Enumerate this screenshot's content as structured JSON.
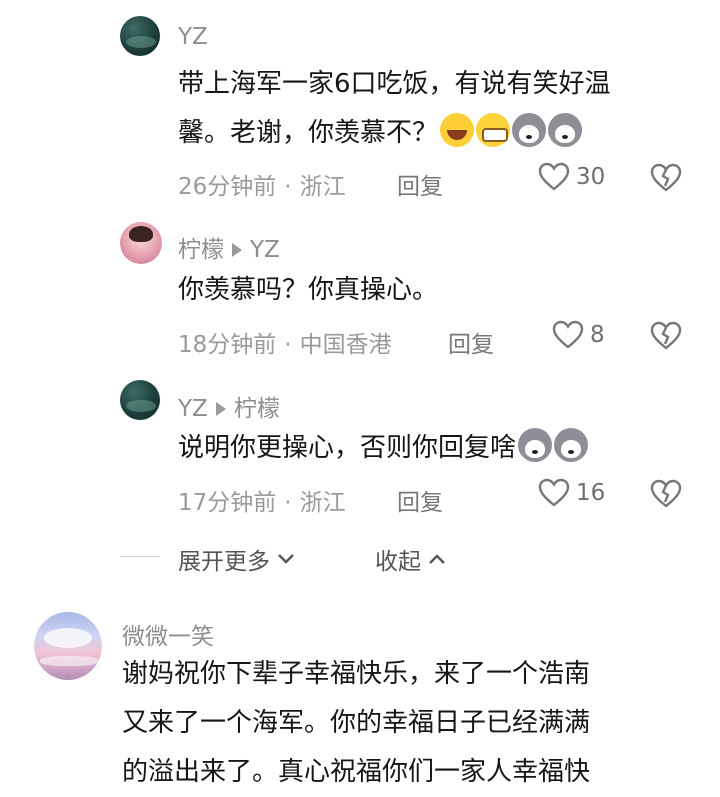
{
  "comments": [
    {
      "author": "YZ",
      "text_line1": "带上海军一家6口吃饭，有说有笑好温",
      "text_line2": "馨。老谢，你羡慕不？",
      "emojis": [
        "laughing-tears-emoji",
        "grin-emoji",
        "husky-emoji",
        "husky-emoji"
      ],
      "time": "26分钟前",
      "location": "浙江",
      "reply_label": "回复",
      "likes": "30"
    },
    {
      "author": "柠檬",
      "reply_to": "YZ",
      "text": "你羡慕吗？你真操心。",
      "time": "18分钟前",
      "location": "中国香港",
      "reply_label": "回复",
      "likes": "8"
    },
    {
      "author": "YZ",
      "reply_to": "柠檬",
      "text": "说明你更操心，否则你回复啥",
      "emojis": [
        "husky-emoji",
        "husky-emoji"
      ],
      "time": "17分钟前",
      "location": "浙江",
      "reply_label": "回复",
      "likes": "16"
    }
  ],
  "thread_controls": {
    "expand_label": "展开更多",
    "collapse_label": "收起"
  },
  "top_comment": {
    "author": "微微一笑",
    "text_line1": "谢妈祝你下辈子幸福快乐，来了一个浩南",
    "text_line2": "又来了一个海军。你的幸福日子已经满满",
    "text_line3": "的溢出来了。真心祝福你们一家人幸福快"
  },
  "separator": "·",
  "colors": {
    "primary_text": "#161616",
    "secondary_text": "#8e8e8e",
    "icon": "#777777",
    "background": "#ffffff"
  }
}
